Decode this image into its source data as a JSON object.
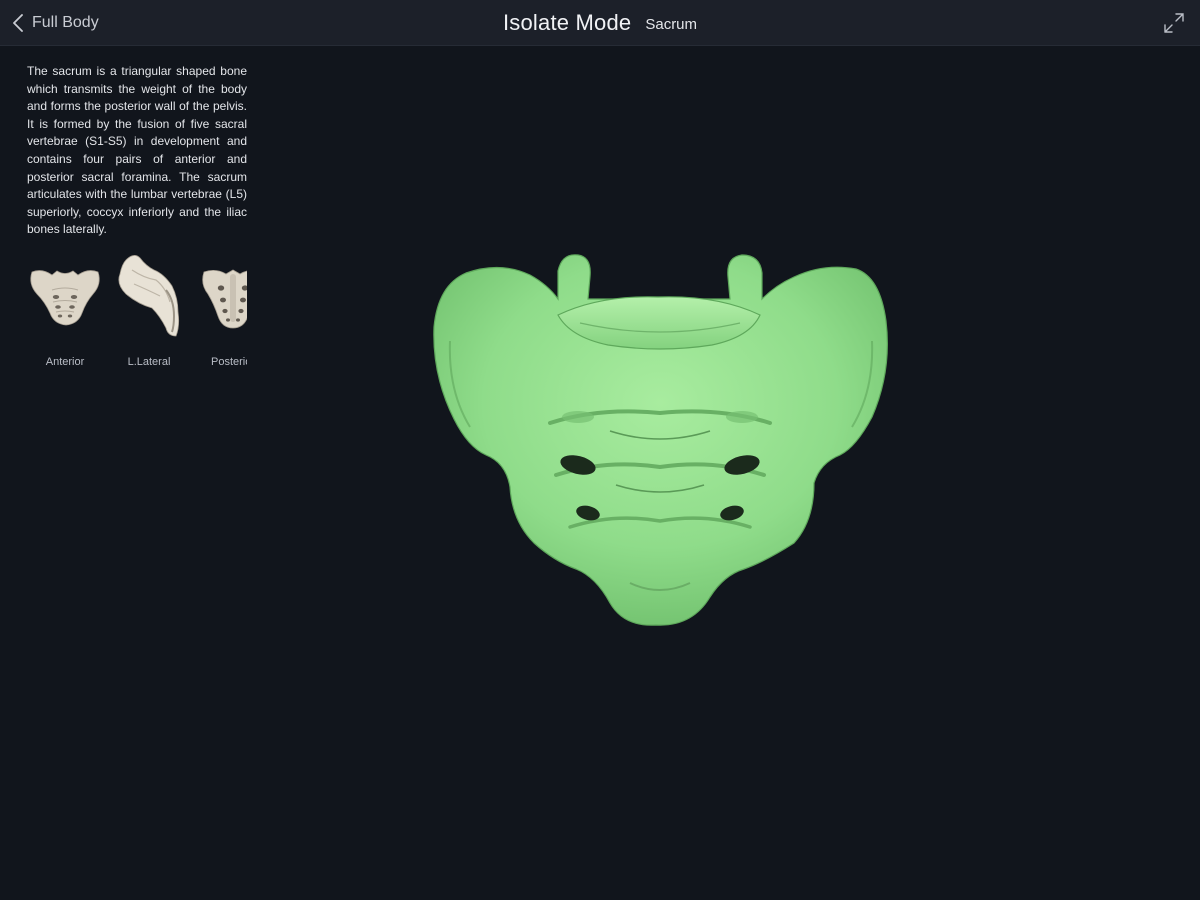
{
  "header": {
    "back_label": "Full Body",
    "title": "Isolate Mode",
    "subtitle": "Sacrum",
    "icons": {
      "back": "chevron-left-icon",
      "expand": "expand-icon"
    }
  },
  "description": "The sacrum is a triangular shaped bone which transmits the weight of the body and forms the posterior wall of the pelvis. It is formed by the fusion of five sacral vertebrae (S1-S5) in development and contains four pairs of anterior and posterior sacral foramina. The sacrum articulates with the lumbar vertebrae (L5) superiorly, coccyx inferiorly and the iliac bones laterally.",
  "views": [
    {
      "label": "Anterior"
    },
    {
      "label": "L.Lateral"
    },
    {
      "label": "Posterior"
    }
  ],
  "colors": {
    "background": "#11151c",
    "topbar": "#1c2029",
    "bone_highlight": "#8fdc8a",
    "bone_thumb": "#ddd6c8"
  }
}
